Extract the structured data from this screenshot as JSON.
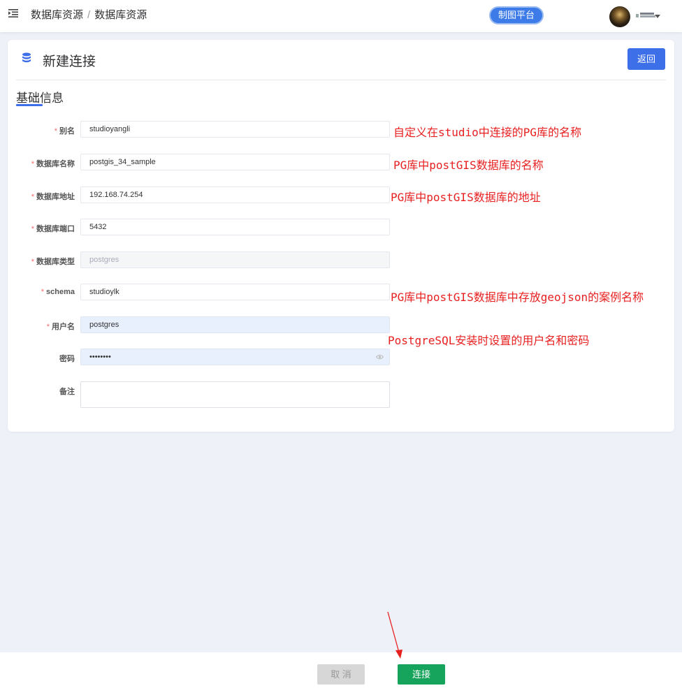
{
  "header": {
    "breadcrumb": [
      "数据库资源",
      "数据库资源"
    ],
    "breadcrumb_separator": "/",
    "platform_button": "制图平台",
    "menu_icon": "menu-fold-icon",
    "caret_icon": "caret-down-icon"
  },
  "card": {
    "title": "新建连接",
    "title_icon": "database-icon",
    "back_button": "返回",
    "section_title": "基础信息"
  },
  "form": {
    "fields": [
      {
        "label": "别名",
        "required": "*",
        "value": "studioyangli"
      },
      {
        "label": "数据库名称",
        "required": "*",
        "value": "postgis_34_sample"
      },
      {
        "label": "数据库地址",
        "required": "*",
        "value": "192.168.74.254"
      },
      {
        "label": "数据库端口",
        "required": "*",
        "value": "5432"
      },
      {
        "label": "数据库类型",
        "required": "*",
        "value": "postgres"
      },
      {
        "label": "schema",
        "required": "*",
        "value": "studioylk"
      },
      {
        "label": "用户名",
        "required": "*",
        "value": "postgres"
      },
      {
        "label": "密码",
        "required": "",
        "value": "••••••••"
      },
      {
        "label": "备注",
        "required": "",
        "value": ""
      }
    ]
  },
  "annotations": [
    "自定义在studio中连接的PG库的名称",
    "PG库中postGIS数据库的名称",
    "PG库中postGIS数据库的地址",
    "PG库中postGIS数据库中存放geojson的案例名称",
    "PostgreSQL安装时设置的用户名和密码"
  ],
  "footer": {
    "cancel_button": "取 消",
    "connect_button": "连接"
  },
  "colors": {
    "primary": "#3d6fe8",
    "connect": "#16a35b",
    "annotation": "#e82020",
    "required": "#f56c6c"
  }
}
